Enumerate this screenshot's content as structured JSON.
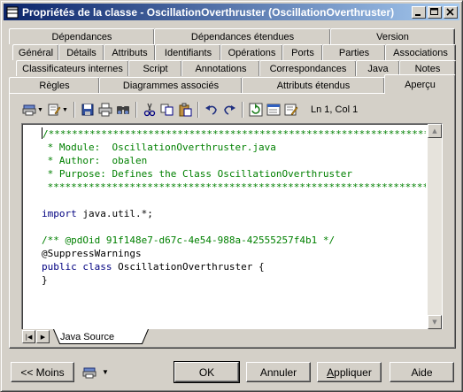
{
  "window": {
    "title": "Propriétés de la classe - OscillationOverthruster (OscillationOverthruster)",
    "minimize": "_",
    "maximize": "□",
    "close": "✕"
  },
  "tabs": {
    "row1": [
      "Dépendances",
      "Dépendances étendues",
      "Version"
    ],
    "row2": [
      "Général",
      "Détails",
      "Attributs",
      "Identifiants",
      "Opérations",
      "Ports",
      "Parties",
      "Associations"
    ],
    "row3": [
      "Classificateurs internes",
      "Script",
      "Annotations",
      "Correspondances",
      "Java",
      "Notes"
    ],
    "row4": [
      "Règles",
      "Diagrammes associés",
      "Attributs étendus",
      "Aperçu"
    ],
    "active": "Aperçu"
  },
  "toolbar": {
    "position_label": "Ln 1, Col 1",
    "icons": [
      "print-icon",
      "edit-icon",
      "save-icon",
      "printer-icon",
      "find-icon",
      "cut-icon",
      "copy-icon",
      "paste-icon",
      "undo-icon",
      "redo-icon",
      "refresh-icon",
      "view-icon",
      "properties-icon"
    ]
  },
  "editor": {
    "lines": [
      {
        "type": "comment",
        "text": "/*************************************************************************"
      },
      {
        "type": "comment",
        "text": " * Module:  OscillationOverthruster.java"
      },
      {
        "type": "comment",
        "text": " * Author:  obalen"
      },
      {
        "type": "comment",
        "text": " * Purpose: Defines the Class OscillationOverthruster"
      },
      {
        "type": "comment",
        "text": " *************************************************************************"
      },
      {
        "type": "blank",
        "text": ""
      },
      {
        "type": "import",
        "kw": "import",
        "text": " java.util.*;"
      },
      {
        "type": "blank",
        "text": ""
      },
      {
        "type": "comment",
        "text": "/** @pdOid 91f148e7-d67c-4e54-988a-42555257f4b1 */"
      },
      {
        "type": "plain",
        "text": "@SuppressWarnings"
      },
      {
        "type": "decl",
        "kw": "public class",
        "text": " OscillationOverthruster {"
      },
      {
        "type": "plain",
        "text": "}"
      }
    ],
    "sheet_tab": "Java Source"
  },
  "buttons": {
    "less": "<< Moins",
    "ok": "OK",
    "cancel": "Annuler",
    "apply": "Appliquer",
    "apply_underline": "A",
    "apply_rest": "ppliquer",
    "help": "Aide"
  },
  "colors": {
    "title_start": "#0a246a",
    "title_end": "#a6caf0",
    "comment": "#008000",
    "keyword": "#000080"
  }
}
